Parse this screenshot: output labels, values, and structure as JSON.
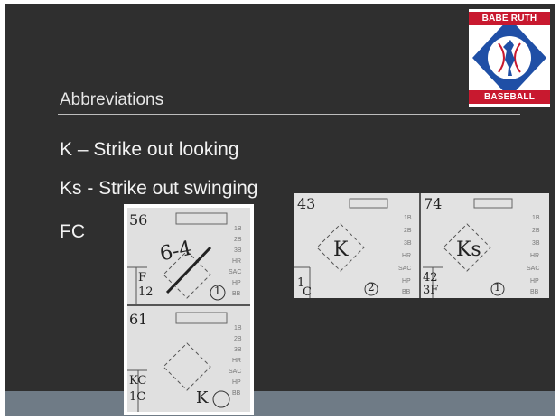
{
  "slide": {
    "subtitle": "Abbreviations",
    "bullets": [
      "K – Strike out looking",
      "Ks - Strike out swinging",
      "FC"
    ]
  },
  "logo": {
    "top_text": "BABE RUTH",
    "bottom_text": "BASEBALL"
  },
  "scorecard_a": {
    "rows": [
      "1B",
      "2B",
      "3B",
      "HR",
      "SAC",
      "HP",
      "BB"
    ],
    "left_cell": {
      "number": "43",
      "mark": "K",
      "circle": "2",
      "extra": [
        "1",
        "C"
      ]
    },
    "right_cell": {
      "number": "74",
      "mark": "Ks",
      "circle": "1",
      "extra": [
        "42",
        "3F"
      ]
    }
  },
  "scorecard_b": {
    "rows": [
      "1B",
      "2B",
      "3B",
      "HR",
      "SAC",
      "HP",
      "BB"
    ],
    "top_cell": {
      "number": "56",
      "mark": "6-4",
      "circle": "1",
      "extra": [
        "F",
        "12"
      ]
    },
    "bottom_cell": {
      "number": "61",
      "mark": "K",
      "extra": [
        "KC",
        "1C"
      ]
    }
  },
  "colors": {
    "background": "#2f2f2f",
    "footer": "#6f7b86",
    "logo_red": "#c8192f",
    "logo_blue": "#1f4fa6"
  }
}
